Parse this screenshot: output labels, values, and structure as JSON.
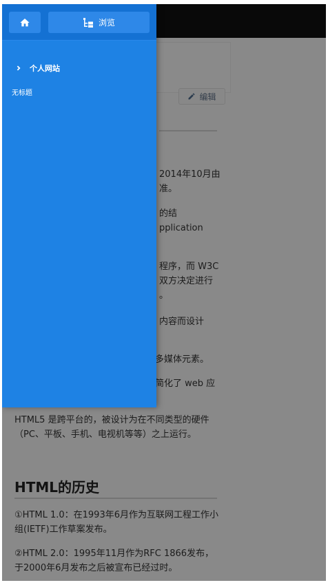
{
  "toolbar": {
    "home_icon": "home-icon",
    "browse_icon": "tree-icon",
    "browse_label": "浏览"
  },
  "drawer": {
    "nav_item_label": "个人网站",
    "nav_item_icon": "chevron-right-icon",
    "page_link_label": "无标题"
  },
  "page": {
    "edit_label": "编辑",
    "edit_icon": "pencil-icon",
    "frag1": "2014年10月由",
    "frag2": "准。",
    "frag3": "的结",
    "frag4": "pplication",
    "frag5": "程序，而 W3C",
    "frag6": "双方决定进行",
    "frag7": "。",
    "frag8": "内容而设计",
    "frag9": "多媒体元素。",
    "frag10": "简化了 web 应",
    "para_platform": "HTML5 是跨平台的，被设计为在不同类型的硬件（PC、平板、手机、电视机等等）之上运行。",
    "history_heading": "HTML的历史",
    "history_1": "①HTML 1.0：在1993年6月作为互联网工程工作小组(IETF)工作草案发布。",
    "history_2": "②HTML 2.0：1995年11月作为RFC 1866发布，于2000年6月发布之后被宣布已经过时。"
  },
  "colors": {
    "drawer_bg": "#1e82e4",
    "drawer_header_bg": "#1471d3",
    "button_bg": "#2e88e8",
    "topbar_bg": "#111111"
  }
}
